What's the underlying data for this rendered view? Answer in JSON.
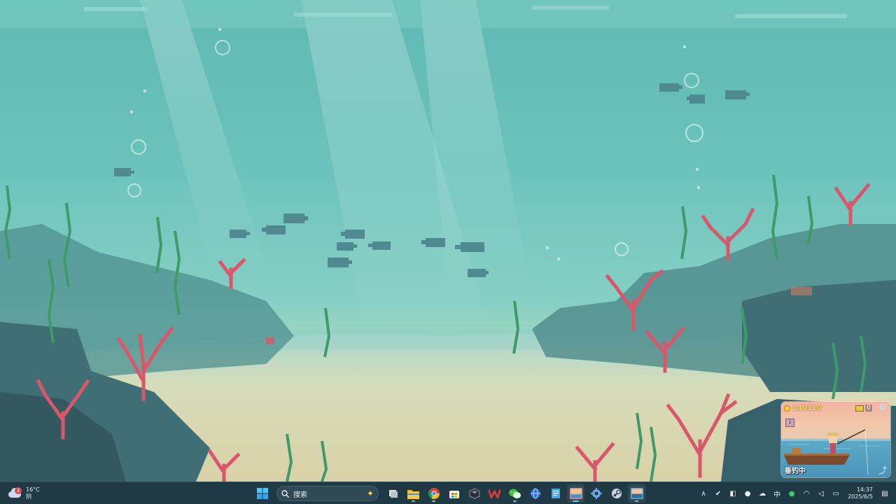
{
  "fishing_widget": {
    "coins": "140110",
    "tickets": "0",
    "status": "垂钓中",
    "info_label": "i"
  },
  "taskbar": {
    "weather": {
      "badge": "3",
      "temperature": "16°C",
      "condition": "阴"
    },
    "search": {
      "label": "搜索"
    },
    "apps": [
      {
        "name": "start",
        "icon": "windows-logo-icon"
      },
      {
        "name": "task-view",
        "icon": "task-view-icon"
      },
      {
        "name": "file-explorer",
        "icon": "folder-icon"
      },
      {
        "name": "chrome",
        "icon": "chrome-icon"
      },
      {
        "name": "microsoft-store",
        "icon": "store-icon"
      },
      {
        "name": "app-cube",
        "icon": "cube-icon"
      },
      {
        "name": "wps-office",
        "icon": "wps-icon"
      },
      {
        "name": "wechat",
        "icon": "wechat-icon"
      },
      {
        "name": "globe-app",
        "icon": "globe-icon"
      },
      {
        "name": "notepad",
        "icon": "notepad-icon"
      },
      {
        "name": "photo-app",
        "icon": "photo-icon"
      },
      {
        "name": "settings-app",
        "icon": "gear-icon"
      },
      {
        "name": "steam",
        "icon": "steam-icon"
      },
      {
        "name": "fishing-game",
        "icon": "fishing-game-icon"
      }
    ],
    "tray": {
      "ime": "中",
      "time": "14:37",
      "date": "2025/6/5"
    }
  },
  "colors": {
    "taskbar_bg": "#1f3a45",
    "water_top": "#5fb8b2",
    "sand": "#cfd8b6",
    "coral": "#d9576b",
    "seaweed": "#3f9a6a",
    "accent": "#5fc8ff"
  }
}
